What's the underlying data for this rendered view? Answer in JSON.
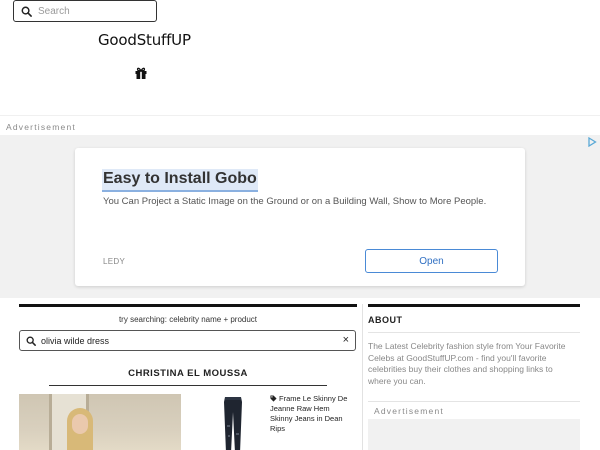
{
  "header": {
    "search_placeholder": "Search",
    "logo_text": "GoodStuffUP",
    "gift_icon": "gift-icon"
  },
  "ads": {
    "label": "Advertisement",
    "card": {
      "title": "Easy to Install Gobo",
      "description": "You Can Project a Static Image on the Ground or on a Building Wall, Show to More People.",
      "brand": "LEDY",
      "cta": "Open"
    }
  },
  "main": {
    "try_text": "try searching: celebrity name + product",
    "search_value": "olivia wilde dress",
    "clear_label": "×",
    "celebrity": "CHRISTINA EL MOUSSA",
    "product_title": "Frame Le Skinny De Jeanne Raw Hem Skinny Jeans in Dean Rips"
  },
  "sidebar": {
    "about_heading": "ABOUT",
    "about_text": "The Latest Celebrity fashion style from Your Favorite Celebs at GoodStuffUP.com - find you'll favorite celebrities buy their clothes and shopping links to where you can.",
    "ad_label": "Advertisement"
  },
  "colors": {
    "accent_blue": "#2f6fc2",
    "ad_background": "#f1f1f1",
    "dark_bar": "#111111"
  }
}
